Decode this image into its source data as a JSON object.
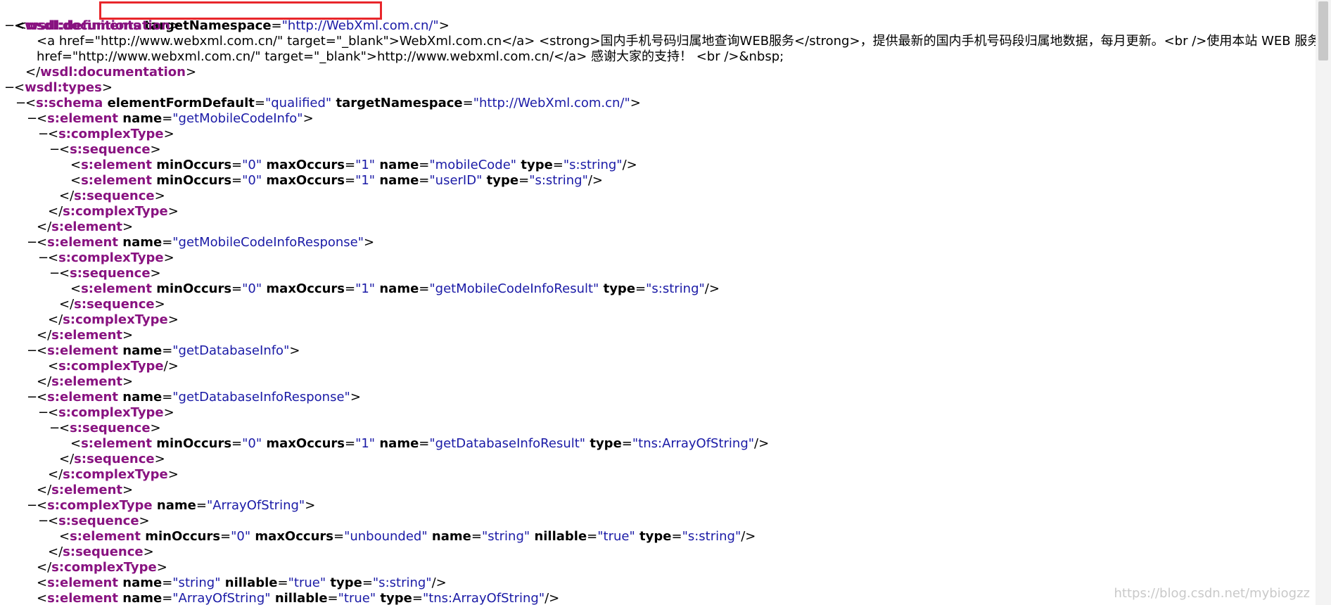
{
  "viewer": {
    "root_prefix": "<",
    "root_tag": "wsdl:definitions",
    "root_attr": "targetNamespace",
    "root_value": "\"http://WebXml.com.cn/\"",
    "lines": [
      {
        "indent": 0,
        "toggle": "−",
        "parts": [
          [
            "br",
            "<"
          ],
          [
            "el",
            "wsdl:documentation"
          ],
          [
            "br",
            ">"
          ]
        ]
      },
      {
        "indent": 2,
        "toggle": "",
        "parts": [
          [
            "tx",
            "<a href=\"http://www.webxml.com.cn/\" target=\"_blank\">WebXml.com.cn</a> <strong>国内手机号码归属地查询WEB服务</strong>，提供最新的国内手机号码段归属地数据，每月更新。<br />使用本站 WEB 服务请注明或链接本站：<a"
          ]
        ]
      },
      {
        "indent": 2,
        "toggle": "",
        "parts": [
          [
            "tx",
            "href=\"http://www.webxml.com.cn/\" target=\"_blank\">http://www.webxml.com.cn/</a> 感谢大家的支持！ <br />&nbsp;"
          ]
        ]
      },
      {
        "indent": 1,
        "toggle": "",
        "parts": [
          [
            "br",
            "</"
          ],
          [
            "el",
            "wsdl:documentation"
          ],
          [
            "br",
            ">"
          ]
        ]
      },
      {
        "indent": 0,
        "toggle": "−",
        "parts": [
          [
            "br",
            "<"
          ],
          [
            "el",
            "wsdl:types"
          ],
          [
            "br",
            ">"
          ]
        ]
      },
      {
        "indent": 1,
        "toggle": "−",
        "parts": [
          [
            "br",
            "<"
          ],
          [
            "el",
            "s:schema"
          ],
          [
            "at",
            " elementFormDefault"
          ],
          [
            "eq",
            "="
          ],
          [
            "va",
            "\"qualified\""
          ],
          [
            "at",
            " targetNamespace"
          ],
          [
            "eq",
            "="
          ],
          [
            "va",
            "\"http://WebXml.com.cn/\""
          ],
          [
            "br",
            ">"
          ]
        ]
      },
      {
        "indent": 2,
        "toggle": "−",
        "parts": [
          [
            "br",
            "<"
          ],
          [
            "el",
            "s:element"
          ],
          [
            "at",
            " name"
          ],
          [
            "eq",
            "="
          ],
          [
            "va",
            "\"getMobileCodeInfo\""
          ],
          [
            "br",
            ">"
          ]
        ]
      },
      {
        "indent": 3,
        "toggle": "−",
        "parts": [
          [
            "br",
            "<"
          ],
          [
            "el",
            "s:complexType"
          ],
          [
            "br",
            ">"
          ]
        ]
      },
      {
        "indent": 4,
        "toggle": "−",
        "parts": [
          [
            "br",
            "<"
          ],
          [
            "el",
            "s:sequence"
          ],
          [
            "br",
            ">"
          ]
        ]
      },
      {
        "indent": 5,
        "toggle": "",
        "parts": [
          [
            "br",
            "<"
          ],
          [
            "el",
            "s:element"
          ],
          [
            "at",
            " minOccurs"
          ],
          [
            "eq",
            "="
          ],
          [
            "va",
            "\"0\""
          ],
          [
            "at",
            " maxOccurs"
          ],
          [
            "eq",
            "="
          ],
          [
            "va",
            "\"1\""
          ],
          [
            "at",
            " name"
          ],
          [
            "eq",
            "="
          ],
          [
            "va",
            "\"mobileCode\""
          ],
          [
            "at",
            " type"
          ],
          [
            "eq",
            "="
          ],
          [
            "va",
            "\"s:string\""
          ],
          [
            "br",
            "/>"
          ]
        ]
      },
      {
        "indent": 5,
        "toggle": "",
        "parts": [
          [
            "br",
            "<"
          ],
          [
            "el",
            "s:element"
          ],
          [
            "at",
            " minOccurs"
          ],
          [
            "eq",
            "="
          ],
          [
            "va",
            "\"0\""
          ],
          [
            "at",
            " maxOccurs"
          ],
          [
            "eq",
            "="
          ],
          [
            "va",
            "\"1\""
          ],
          [
            "at",
            " name"
          ],
          [
            "eq",
            "="
          ],
          [
            "va",
            "\"userID\""
          ],
          [
            "at",
            " type"
          ],
          [
            "eq",
            "="
          ],
          [
            "va",
            "\"s:string\""
          ],
          [
            "br",
            "/>"
          ]
        ]
      },
      {
        "indent": 4,
        "toggle": "",
        "parts": [
          [
            "br",
            "</"
          ],
          [
            "el",
            "s:sequence"
          ],
          [
            "br",
            ">"
          ]
        ]
      },
      {
        "indent": 3,
        "toggle": "",
        "parts": [
          [
            "br",
            "</"
          ],
          [
            "el",
            "s:complexType"
          ],
          [
            "br",
            ">"
          ]
        ]
      },
      {
        "indent": 2,
        "toggle": "",
        "parts": [
          [
            "br",
            "</"
          ],
          [
            "el",
            "s:element"
          ],
          [
            "br",
            ">"
          ]
        ]
      },
      {
        "indent": 2,
        "toggle": "−",
        "parts": [
          [
            "br",
            "<"
          ],
          [
            "el",
            "s:element"
          ],
          [
            "at",
            " name"
          ],
          [
            "eq",
            "="
          ],
          [
            "va",
            "\"getMobileCodeInfoResponse\""
          ],
          [
            "br",
            ">"
          ]
        ]
      },
      {
        "indent": 3,
        "toggle": "−",
        "parts": [
          [
            "br",
            "<"
          ],
          [
            "el",
            "s:complexType"
          ],
          [
            "br",
            ">"
          ]
        ]
      },
      {
        "indent": 4,
        "toggle": "−",
        "parts": [
          [
            "br",
            "<"
          ],
          [
            "el",
            "s:sequence"
          ],
          [
            "br",
            ">"
          ]
        ]
      },
      {
        "indent": 5,
        "toggle": "",
        "parts": [
          [
            "br",
            "<"
          ],
          [
            "el",
            "s:element"
          ],
          [
            "at",
            " minOccurs"
          ],
          [
            "eq",
            "="
          ],
          [
            "va",
            "\"0\""
          ],
          [
            "at",
            " maxOccurs"
          ],
          [
            "eq",
            "="
          ],
          [
            "va",
            "\"1\""
          ],
          [
            "at",
            " name"
          ],
          [
            "eq",
            "="
          ],
          [
            "va",
            "\"getMobileCodeInfoResult\""
          ],
          [
            "at",
            " type"
          ],
          [
            "eq",
            "="
          ],
          [
            "va",
            "\"s:string\""
          ],
          [
            "br",
            "/>"
          ]
        ]
      },
      {
        "indent": 4,
        "toggle": "",
        "parts": [
          [
            "br",
            "</"
          ],
          [
            "el",
            "s:sequence"
          ],
          [
            "br",
            ">"
          ]
        ]
      },
      {
        "indent": 3,
        "toggle": "",
        "parts": [
          [
            "br",
            "</"
          ],
          [
            "el",
            "s:complexType"
          ],
          [
            "br",
            ">"
          ]
        ]
      },
      {
        "indent": 2,
        "toggle": "",
        "parts": [
          [
            "br",
            "</"
          ],
          [
            "el",
            "s:element"
          ],
          [
            "br",
            ">"
          ]
        ]
      },
      {
        "indent": 2,
        "toggle": "−",
        "parts": [
          [
            "br",
            "<"
          ],
          [
            "el",
            "s:element"
          ],
          [
            "at",
            " name"
          ],
          [
            "eq",
            "="
          ],
          [
            "va",
            "\"getDatabaseInfo\""
          ],
          [
            "br",
            ">"
          ]
        ]
      },
      {
        "indent": 3,
        "toggle": "",
        "parts": [
          [
            "br",
            "<"
          ],
          [
            "el",
            "s:complexType"
          ],
          [
            "br",
            "/>"
          ]
        ]
      },
      {
        "indent": 2,
        "toggle": "",
        "parts": [
          [
            "br",
            "</"
          ],
          [
            "el",
            "s:element"
          ],
          [
            "br",
            ">"
          ]
        ]
      },
      {
        "indent": 2,
        "toggle": "−",
        "parts": [
          [
            "br",
            "<"
          ],
          [
            "el",
            "s:element"
          ],
          [
            "at",
            " name"
          ],
          [
            "eq",
            "="
          ],
          [
            "va",
            "\"getDatabaseInfoResponse\""
          ],
          [
            "br",
            ">"
          ]
        ]
      },
      {
        "indent": 3,
        "toggle": "−",
        "parts": [
          [
            "br",
            "<"
          ],
          [
            "el",
            "s:complexType"
          ],
          [
            "br",
            ">"
          ]
        ]
      },
      {
        "indent": 4,
        "toggle": "−",
        "parts": [
          [
            "br",
            "<"
          ],
          [
            "el",
            "s:sequence"
          ],
          [
            "br",
            ">"
          ]
        ]
      },
      {
        "indent": 5,
        "toggle": "",
        "parts": [
          [
            "br",
            "<"
          ],
          [
            "el",
            "s:element"
          ],
          [
            "at",
            " minOccurs"
          ],
          [
            "eq",
            "="
          ],
          [
            "va",
            "\"0\""
          ],
          [
            "at",
            " maxOccurs"
          ],
          [
            "eq",
            "="
          ],
          [
            "va",
            "\"1\""
          ],
          [
            "at",
            " name"
          ],
          [
            "eq",
            "="
          ],
          [
            "va",
            "\"getDatabaseInfoResult\""
          ],
          [
            "at",
            " type"
          ],
          [
            "eq",
            "="
          ],
          [
            "va",
            "\"tns:ArrayOfString\""
          ],
          [
            "br",
            "/>"
          ]
        ]
      },
      {
        "indent": 4,
        "toggle": "",
        "parts": [
          [
            "br",
            "</"
          ],
          [
            "el",
            "s:sequence"
          ],
          [
            "br",
            ">"
          ]
        ]
      },
      {
        "indent": 3,
        "toggle": "",
        "parts": [
          [
            "br",
            "</"
          ],
          [
            "el",
            "s:complexType"
          ],
          [
            "br",
            ">"
          ]
        ]
      },
      {
        "indent": 2,
        "toggle": "",
        "parts": [
          [
            "br",
            "</"
          ],
          [
            "el",
            "s:element"
          ],
          [
            "br",
            ">"
          ]
        ]
      },
      {
        "indent": 2,
        "toggle": "−",
        "parts": [
          [
            "br",
            "<"
          ],
          [
            "el",
            "s:complexType"
          ],
          [
            "at",
            " name"
          ],
          [
            "eq",
            "="
          ],
          [
            "va",
            "\"ArrayOfString\""
          ],
          [
            "br",
            ">"
          ]
        ]
      },
      {
        "indent": 3,
        "toggle": "−",
        "parts": [
          [
            "br",
            "<"
          ],
          [
            "el",
            "s:sequence"
          ],
          [
            "br",
            ">"
          ]
        ]
      },
      {
        "indent": 4,
        "toggle": "",
        "parts": [
          [
            "br",
            "<"
          ],
          [
            "el",
            "s:element"
          ],
          [
            "at",
            " minOccurs"
          ],
          [
            "eq",
            "="
          ],
          [
            "va",
            "\"0\""
          ],
          [
            "at",
            " maxOccurs"
          ],
          [
            "eq",
            "="
          ],
          [
            "va",
            "\"unbounded\""
          ],
          [
            "at",
            " name"
          ],
          [
            "eq",
            "="
          ],
          [
            "va",
            "\"string\""
          ],
          [
            "at",
            " nillable"
          ],
          [
            "eq",
            "="
          ],
          [
            "va",
            "\"true\""
          ],
          [
            "at",
            " type"
          ],
          [
            "eq",
            "="
          ],
          [
            "va",
            "\"s:string\""
          ],
          [
            "br",
            "/>"
          ]
        ]
      },
      {
        "indent": 3,
        "toggle": "",
        "parts": [
          [
            "br",
            "</"
          ],
          [
            "el",
            "s:sequence"
          ],
          [
            "br",
            ">"
          ]
        ]
      },
      {
        "indent": 2,
        "toggle": "",
        "parts": [
          [
            "br",
            "</"
          ],
          [
            "el",
            "s:complexType"
          ],
          [
            "br",
            ">"
          ]
        ]
      },
      {
        "indent": 2,
        "toggle": "",
        "parts": [
          [
            "br",
            "<"
          ],
          [
            "el",
            "s:element"
          ],
          [
            "at",
            " name"
          ],
          [
            "eq",
            "="
          ],
          [
            "va",
            "\"string\""
          ],
          [
            "at",
            " nillable"
          ],
          [
            "eq",
            "="
          ],
          [
            "va",
            "\"true\""
          ],
          [
            "at",
            " type"
          ],
          [
            "eq",
            "="
          ],
          [
            "va",
            "\"s:string\""
          ],
          [
            "br",
            "/>"
          ]
        ]
      },
      {
        "indent": 2,
        "toggle": "",
        "parts": [
          [
            "br",
            "<"
          ],
          [
            "el",
            "s:element"
          ],
          [
            "at",
            " name"
          ],
          [
            "eq",
            "="
          ],
          [
            "va",
            "\"ArrayOfString\""
          ],
          [
            "at",
            " nillable"
          ],
          [
            "eq",
            "="
          ],
          [
            "va",
            "\"true\""
          ],
          [
            "at",
            " type"
          ],
          [
            "eq",
            "="
          ],
          [
            "va",
            "\"tns:ArrayOfString\""
          ],
          [
            "br",
            "/>"
          ]
        ]
      }
    ]
  },
  "watermark": "https://blog.csdn.net/mybiogzz",
  "colors": {
    "element": "#881280",
    "value": "#1a1aa6",
    "highlight_box": "#e8262b"
  }
}
